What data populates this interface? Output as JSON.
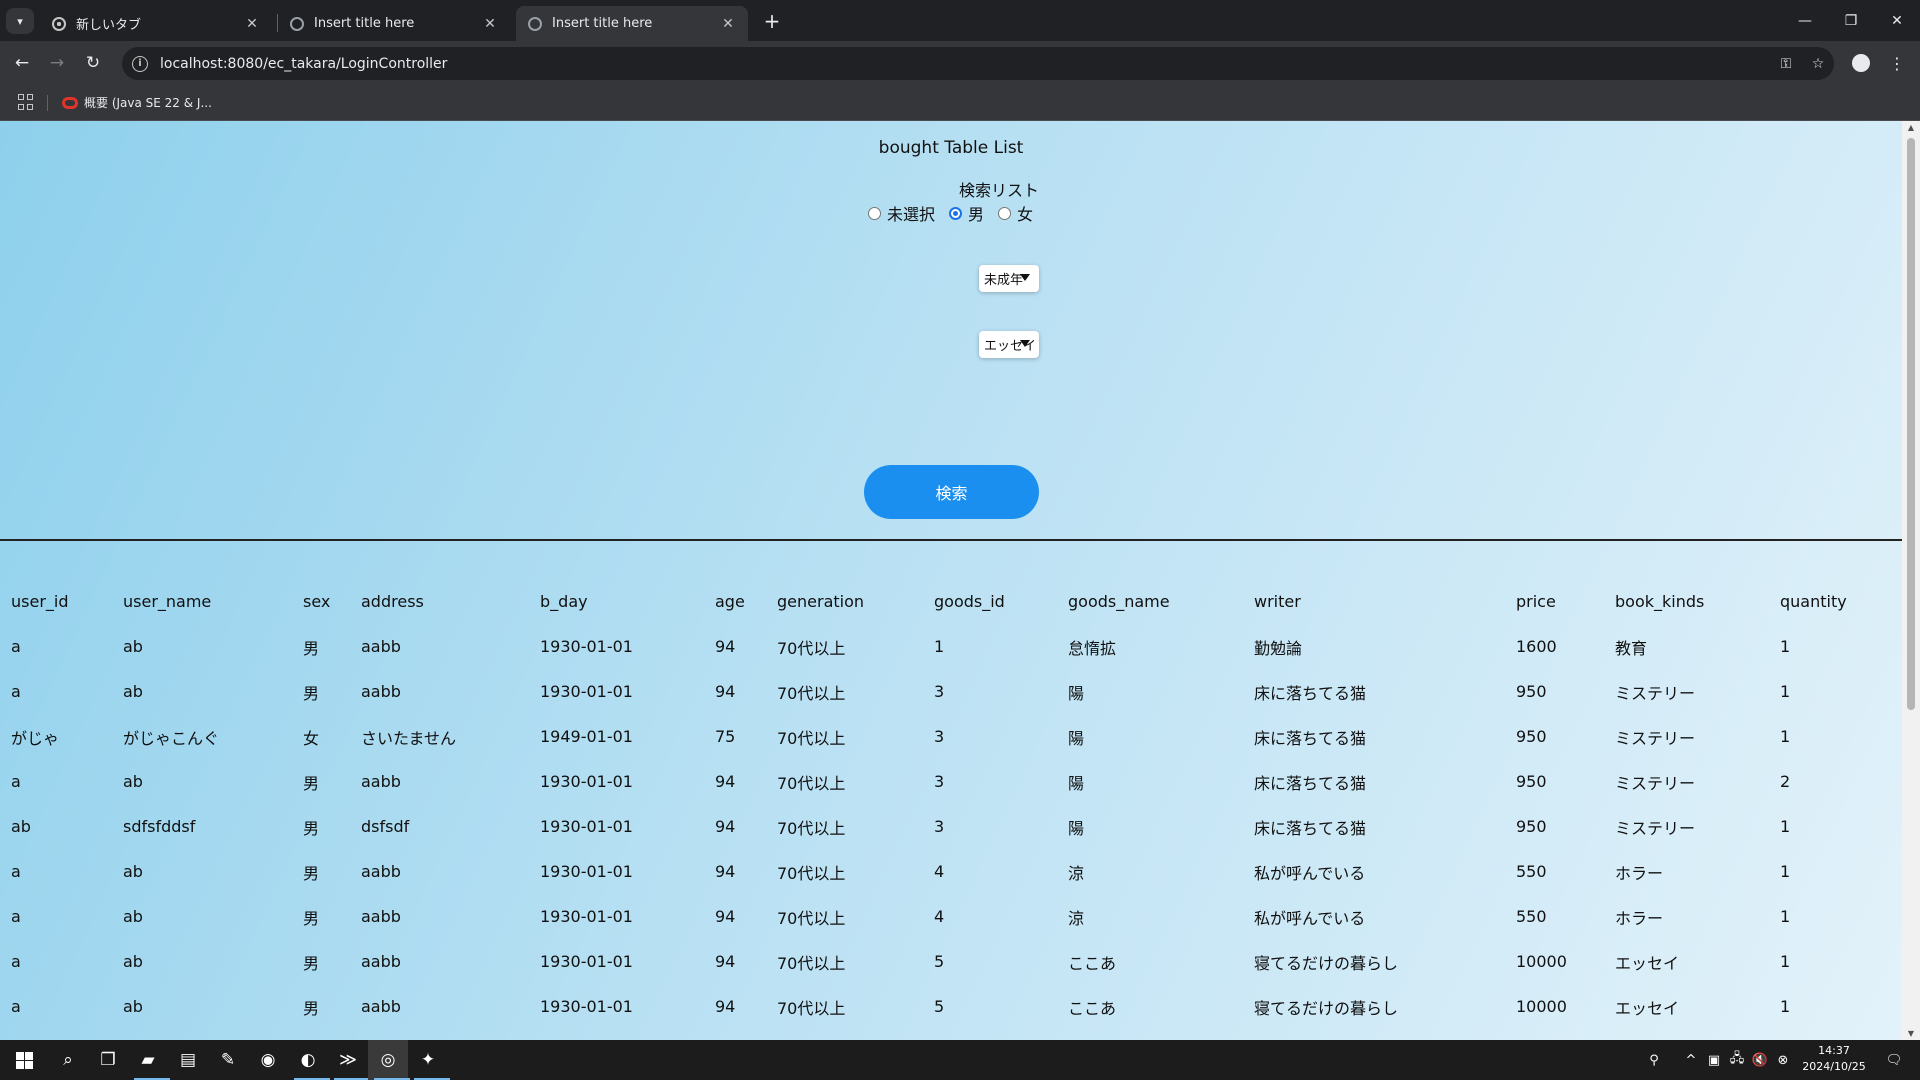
{
  "browser": {
    "tabs": [
      {
        "title": "新しいタブ",
        "active": false,
        "favicon": "chrome-icon"
      },
      {
        "title": "Insert title here",
        "active": false,
        "favicon": "globe-icon"
      },
      {
        "title": "Insert title here",
        "active": true,
        "favicon": "globe-icon"
      }
    ],
    "url": "localhost:8080/ec_takara/LoginController",
    "bookmarks": [
      {
        "label": "概要 (Java SE 22 & J..."
      }
    ]
  },
  "page": {
    "title": "bought Table List",
    "search_label": "検索リスト",
    "radios": [
      {
        "label": "未選択",
        "checked": false
      },
      {
        "label": "男",
        "checked": true
      },
      {
        "label": "女",
        "checked": false
      }
    ],
    "select_age": "未成年",
    "select_kind": "エッセイ",
    "search_button": "検索"
  },
  "table": {
    "columns": [
      "user_id",
      "user_name",
      "sex",
      "address",
      "b_day",
      "age",
      "generation",
      "goods_id",
      "goods_name",
      "writer",
      "price",
      "book_kinds",
      "quantity"
    ],
    "rows": [
      [
        "a",
        "ab",
        "男",
        "aabb",
        "1930-01-01",
        "94",
        "70代以上",
        "1",
        "怠惰拡",
        "勤勉論",
        "1600",
        "教育",
        "1"
      ],
      [
        "a",
        "ab",
        "男",
        "aabb",
        "1930-01-01",
        "94",
        "70代以上",
        "3",
        "陽",
        "床に落ちてる猫",
        "950",
        "ミステリー",
        "1"
      ],
      [
        "がじゃ",
        "がじゃこんぐ",
        "女",
        "さいたません",
        "1949-01-01",
        "75",
        "70代以上",
        "3",
        "陽",
        "床に落ちてる猫",
        "950",
        "ミステリー",
        "1"
      ],
      [
        "a",
        "ab",
        "男",
        "aabb",
        "1930-01-01",
        "94",
        "70代以上",
        "3",
        "陽",
        "床に落ちてる猫",
        "950",
        "ミステリー",
        "2"
      ],
      [
        "ab",
        "sdfsfddsf",
        "男",
        "dsfsdf",
        "1930-01-01",
        "94",
        "70代以上",
        "3",
        "陽",
        "床に落ちてる猫",
        "950",
        "ミステリー",
        "1"
      ],
      [
        "a",
        "ab",
        "男",
        "aabb",
        "1930-01-01",
        "94",
        "70代以上",
        "4",
        "涼",
        "私が呼んでいる",
        "550",
        "ホラー",
        "1"
      ],
      [
        "a",
        "ab",
        "男",
        "aabb",
        "1930-01-01",
        "94",
        "70代以上",
        "4",
        "涼",
        "私が呼んでいる",
        "550",
        "ホラー",
        "1"
      ],
      [
        "a",
        "ab",
        "男",
        "aabb",
        "1930-01-01",
        "94",
        "70代以上",
        "5",
        "ここあ",
        "寝てるだけの暮らし",
        "10000",
        "エッセイ",
        "1"
      ],
      [
        "a",
        "ab",
        "男",
        "aabb",
        "1930-01-01",
        "94",
        "70代以上",
        "5",
        "ここあ",
        "寝てるだけの暮らし",
        "10000",
        "エッセイ",
        "1"
      ]
    ]
  },
  "taskbar": {
    "time": "14:37",
    "date": "2024/10/25",
    "apps": [
      {
        "name": "search-icon",
        "running": false
      },
      {
        "name": "task-view-icon",
        "running": false
      },
      {
        "name": "file-explorer-icon",
        "running": true
      },
      {
        "name": "notepad-icon",
        "running": false
      },
      {
        "name": "notes-icon",
        "running": false
      },
      {
        "name": "edge-icon",
        "running": false
      },
      {
        "name": "eclipse-icon",
        "running": true
      },
      {
        "name": "powershell-icon",
        "running": true
      },
      {
        "name": "chrome-icon",
        "running": true
      },
      {
        "name": "app-icon",
        "running": true
      }
    ]
  },
  "colors": {
    "accent": "#1a8ff0",
    "page_bg_start": "#8ed0ec",
    "page_bg_end": "#e3f2fa"
  }
}
